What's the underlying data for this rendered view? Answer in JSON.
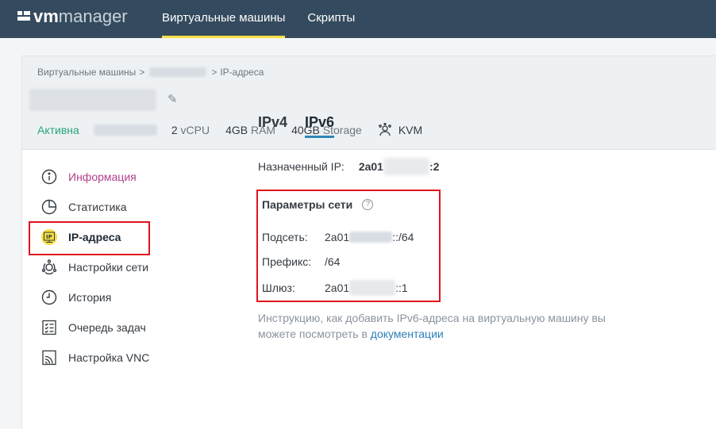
{
  "header": {
    "logo_vm": "vm",
    "logo_manager": "manager",
    "nav": [
      {
        "label": "Виртуальные машины"
      },
      {
        "label": "Скрипты"
      }
    ]
  },
  "breadcrumb": {
    "root": "Виртуальные машины",
    "sep1": ">",
    "sep2": ">",
    "current": "IP-адреса"
  },
  "vm": {
    "status": "Активна",
    "cpu_num": "2",
    "cpu_unit": "vCPU",
    "ram_num": "4GB",
    "ram_unit": "RAM",
    "storage_num": "40GB",
    "storage_unit": "Storage",
    "virt": "KVM"
  },
  "sidebar": {
    "items": [
      {
        "label": "Информация"
      },
      {
        "label": "Статистика"
      },
      {
        "label": "IP-адреса"
      },
      {
        "label": "Настройки сети"
      },
      {
        "label": "История"
      },
      {
        "label": "Очередь задач"
      },
      {
        "label": "Настройка VNC"
      }
    ]
  },
  "tabs": [
    {
      "label": "IPv4"
    },
    {
      "label": "IPv6"
    }
  ],
  "assigned": {
    "label": "Назначенный IP:",
    "value_prefix": "2a01",
    "value_suffix": ":2"
  },
  "network": {
    "title": "Параметры сети",
    "help": "?",
    "subnet_label": "Подсеть:",
    "subnet_prefix": "2a01",
    "subnet_suffix": "::/64",
    "prefix_label": "Префикс:",
    "prefix_value": "/64",
    "gateway_label": "Шлюз:",
    "gateway_prefix": "2a01",
    "gateway_suffix": "::1"
  },
  "note": {
    "text": "Инструкцию, как добавить IPv6-адреса на виртуальную машину вы можете посмотреть в ",
    "link": "документации"
  },
  "colors": {
    "topbar": "#344a5e",
    "nav_underline": "#f6e044",
    "status_active": "#27a37b",
    "info_accent": "#b3408b",
    "tab_underline": "#2d86b8",
    "highlight": "#e0141e",
    "link": "#2d7fb8"
  }
}
